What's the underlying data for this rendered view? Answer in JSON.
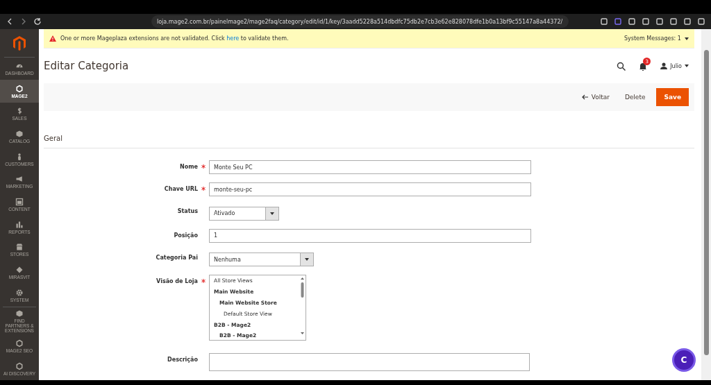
{
  "browser": {
    "url": "loja.mage2.com.br/painelmage2/mage2faq/category/edit/id/1/key/3aadd5228a514dbdfc75db2e7cb3e62e828078dfe1b0a13bf9c55147a8a44372/"
  },
  "sidebar": {
    "items": [
      {
        "label": "DASHBOARD",
        "selected": false
      },
      {
        "label": "MAGE2",
        "selected": true
      },
      {
        "label": "SALES",
        "selected": false
      },
      {
        "label": "CATALOG",
        "selected": false
      },
      {
        "label": "CUSTOMERS",
        "selected": false
      },
      {
        "label": "MARKETING",
        "selected": false
      },
      {
        "label": "CONTENT",
        "selected": false
      },
      {
        "label": "REPORTS",
        "selected": false
      },
      {
        "label": "STORES",
        "selected": false
      },
      {
        "label": "MIRASVIT",
        "selected": false
      },
      {
        "label": "SYSTEM",
        "selected": false
      },
      {
        "label": "FIND PARTNERS & EXTENSIONS",
        "selected": false
      },
      {
        "label": "MAGE2 SEO",
        "selected": false
      },
      {
        "label": "AI DISCOVERY",
        "selected": false
      }
    ]
  },
  "notice": {
    "before": "One or more Mageplaza extensions are not validated. Click ",
    "link": "here",
    "after": " to validate them.",
    "system_messages": "System Messages: 1"
  },
  "header": {
    "title": "Editar Categoria",
    "notifications": "3",
    "user": "Julio"
  },
  "actions": {
    "back": "Voltar",
    "delete": "Delete",
    "save": "Save"
  },
  "section": {
    "title": "Geral"
  },
  "fields": [
    {
      "kind": "text",
      "label": "Nome",
      "required": true,
      "value": "Monte Seu PC"
    },
    {
      "kind": "text",
      "label": "Chave URL",
      "required": true,
      "value": "monte-seu-pc"
    },
    {
      "kind": "select",
      "label": "Status",
      "required": false,
      "value": "Ativado"
    },
    {
      "kind": "text",
      "label": "Posição",
      "required": false,
      "value": "1"
    },
    {
      "kind": "select",
      "label": "Categoria Pai",
      "required": false,
      "value": "Nenhuma"
    },
    {
      "kind": "multiselect",
      "label": "Visão de Loja",
      "required": true,
      "options": [
        {
          "label": "All Store Views",
          "kind": "view"
        },
        {
          "label": "Main Website",
          "kind": "website",
          "children": [
            {
              "label": "Main Website Store",
              "kind": "store",
              "children": [
                {
                  "label": "Default Store View",
                  "kind": "view"
                }
              ]
            }
          ]
        },
        {
          "label": "B2B - Mage2",
          "kind": "website",
          "children": [
            {
              "label": "B2B - Mage2",
              "kind": "store"
            }
          ]
        }
      ]
    },
    {
      "kind": "textarea",
      "label": "Descrição",
      "required": false
    }
  ],
  "chat": {
    "label": "C"
  }
}
